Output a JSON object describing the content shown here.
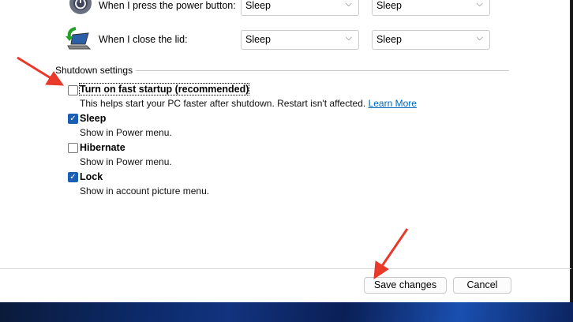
{
  "power_rows": [
    {
      "label": "When I press the power button:",
      "on_battery": "Sleep",
      "plugged_in": "Sleep"
    },
    {
      "label": "When I close the lid:",
      "on_battery": "Sleep",
      "plugged_in": "Sleep"
    }
  ],
  "shutdown": {
    "heading": "Shutdown settings",
    "items": [
      {
        "label": "Turn on fast startup (recommended)",
        "desc": "This helps start your PC faster after shutdown. Restart isn't affected.",
        "checked": false
      },
      {
        "label": "Sleep",
        "desc": "Show in Power menu.",
        "checked": true
      },
      {
        "label": "Hibernate",
        "desc": "Show in Power menu.",
        "checked": false
      },
      {
        "label": "Lock",
        "desc": "Show in account picture menu.",
        "checked": true
      }
    ],
    "learn_more": "Learn More"
  },
  "buttons": {
    "save": "Save changes",
    "cancel": "Cancel"
  },
  "check_glyph": "✓",
  "chevron": "⌵",
  "colors": {
    "accent": "#1a5fb4",
    "link": "#0067c0",
    "arrow": "#e8392b"
  }
}
